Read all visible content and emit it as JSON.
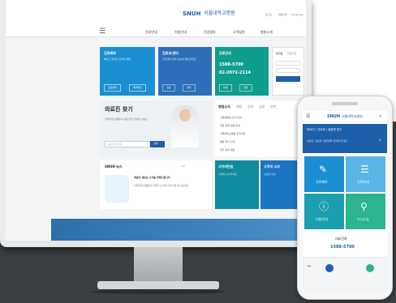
{
  "site": {
    "logo": "SNUH",
    "logo_kr": "서울대학교병원",
    "topbar": [
      "로그인",
      "회원가입",
      "Language"
    ]
  },
  "nav": [
    "진료안내",
    "이용안내",
    "건강정보",
    "고객참여",
    "병원소개"
  ],
  "tiles": [
    {
      "title": "진료예약",
      "desc": "빠르고 편리한 온라인 예약",
      "b1": "진료예약",
      "b2": "예약확인",
      "color": "#1b8fd1"
    },
    {
      "title": "진료과/센터",
      "desc": "진료과와 센터 정보를 확인하세요",
      "b1": "진료",
      "b2": "센터",
      "color": "#2c6fb8"
    },
    {
      "title": "진료안내",
      "desc": "",
      "phone1": "1588-5700",
      "phone2": "02-2072-2114",
      "b1": "외래",
      "b2": "입원",
      "color": "#0f9e8c"
    }
  ],
  "login": {
    "tabs": [
      "로그인",
      "회원가입"
    ],
    "links": [
      "아이디찾기",
      "비밀번호찾기"
    ]
  },
  "doctor": {
    "title": "의료진 찾기",
    "desc": "서울대학교병원의 의료진을 검색해 보세요",
    "placeholder": "의료진명 검색",
    "button": "검색"
  },
  "news": {
    "tabs": [
      "병원소식",
      "채용",
      "공지",
      "입찰",
      "언론"
    ],
    "items": [
      "서울대병원 소식 안내",
      "진료 일정 변경 안내",
      "서울대학교병원 공지사항",
      "병원 행사 안내",
      "연구 성과 발표"
    ]
  },
  "snuh_story": {
    "title": "SNUH 뉴스",
    "pages": "1/3",
    "headline": "병원의 새로운 소식을 전해드립니다",
    "body": "서울대학교병원의 다양한 소식과 이야기를 만나보세요"
  },
  "bottom_tiles": [
    {
      "title": "사이버민원",
      "desc": "의견을 남겨주세요",
      "color": "#0f8a9e"
    },
    {
      "title": "고객의 소리",
      "desc": "소중한 의견",
      "color": "#1b74c1"
    }
  ],
  "mobile": {
    "search_label": "의료진 / 진료과 / 질환명 찾기",
    "search_placeholder": "의료진, 진료과, 질환명을 입력해 주세요",
    "tiles": [
      {
        "label": "진료예약",
        "icon": "✎"
      },
      {
        "label": "진료안내",
        "icon": "☰"
      },
      {
        "label": "이용안내",
        "icon": "ⓘ"
      },
      {
        "label": "오시는길",
        "icon": "⚲"
      }
    ],
    "phone_label": "대표전화",
    "phone": "1588-5700"
  }
}
